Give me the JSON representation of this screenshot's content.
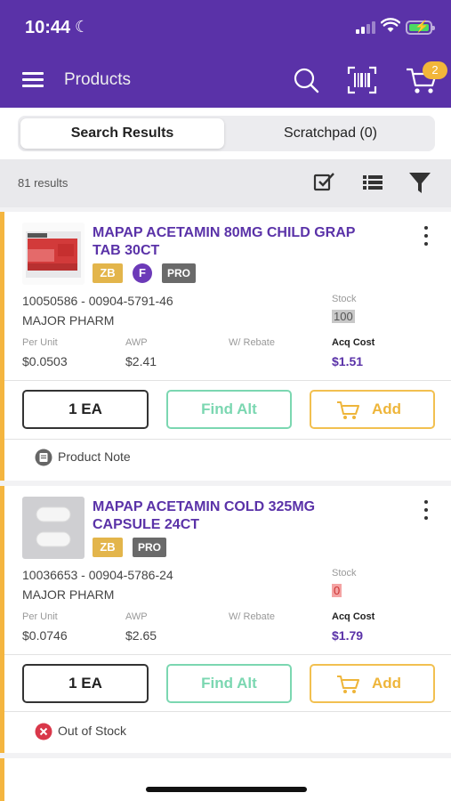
{
  "status_bar": {
    "time": "10:44"
  },
  "header": {
    "title": "Products",
    "cart_count": "2"
  },
  "tabs": [
    {
      "label": "Search Results",
      "active": true
    },
    {
      "label": "Scratchpad (0)",
      "active": false
    }
  ],
  "results": {
    "count_label": "81 results"
  },
  "labels": {
    "per_unit": "Per Unit",
    "awp": "AWP",
    "rebate": "W/ Rebate",
    "acq_cost": "Acq Cost",
    "stock": "Stock",
    "find_alt": "Find Alt",
    "add": "Add"
  },
  "products": [
    {
      "name": "MAPAP ACETAMIN 80MG CHILD GRAP TAB 30CT",
      "badges": [
        "ZB",
        "F",
        "PRO"
      ],
      "codes": "10050586 - 00904-5791-46",
      "manufacturer": "MAJOR PHARM",
      "stock": "100",
      "per_unit": "$0.0503",
      "awp": "$2.41",
      "acq_cost": "$1.51",
      "quantity": "1 EA",
      "footer_note": "Product Note"
    },
    {
      "name": "MAPAP ACETAMIN COLD 325MG CAPSULE 24CT",
      "badges": [
        "ZB",
        "PRO"
      ],
      "codes": "10036653 - 00904-5786-24",
      "manufacturer": "MAJOR PHARM",
      "stock": "0",
      "per_unit": "$0.0746",
      "awp": "$2.65",
      "acq_cost": "$1.79",
      "quantity": "1 EA",
      "footer_note": "Out of Stock"
    }
  ],
  "colors": {
    "brand_purple": "#5a32a8",
    "accent_yellow": "#f4b53f",
    "find_alt_green": "#7bd7b1",
    "out_of_stock_red": "#d9384a"
  }
}
